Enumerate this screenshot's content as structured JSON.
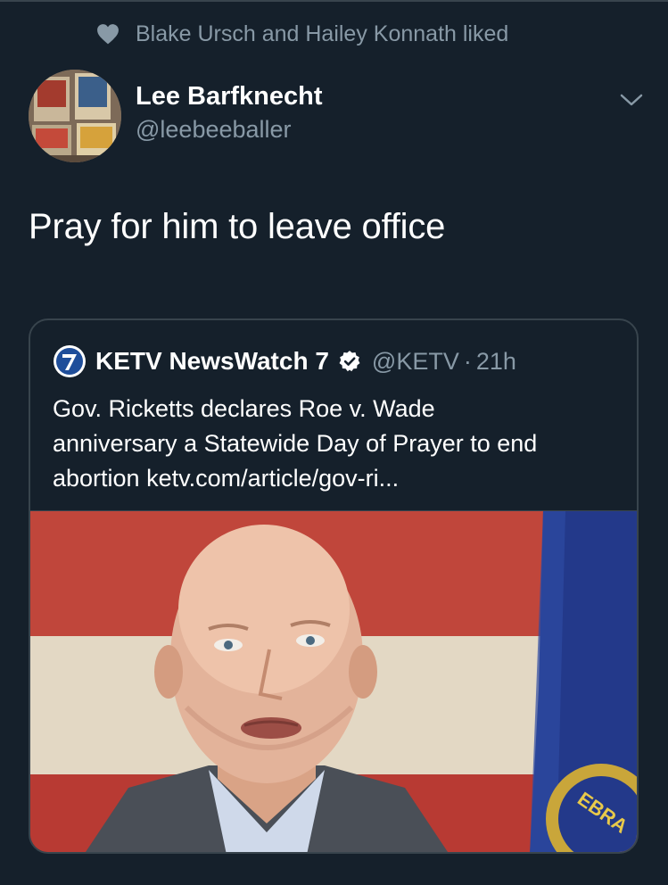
{
  "social_context": {
    "text": "Blake Ursch and Hailey Konnath liked",
    "icon": "heart-icon"
  },
  "tweet": {
    "author_name": "Lee Barfknecht",
    "author_handle": "@leebeeballer",
    "text": "Pray for him to leave office"
  },
  "quoted_tweet": {
    "author_name": "KETV NewsWatch 7",
    "author_handle": "@KETV",
    "separator": "·",
    "timestamp": "21h",
    "verified": true,
    "body_lines": [
      "Gov. Ricketts declares Roe v. Wade",
      "anniversary a Statewide Day of Prayer to end",
      "abortion ketv.com/article/gov-ri..."
    ],
    "image_flag_text": "EBRA"
  },
  "colors": {
    "background": "#15202b",
    "border": "#38444d",
    "secondary_text": "#8899a6",
    "primary_text": "#ffffff"
  }
}
